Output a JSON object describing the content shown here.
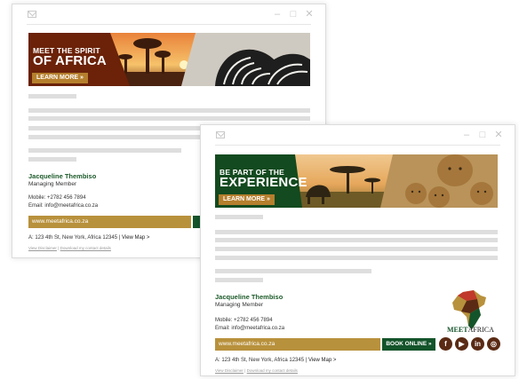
{
  "window_controls": {
    "minimize": "–",
    "maximize": "□",
    "close": "✕"
  },
  "email1": {
    "banner": {
      "line1": "MEET THE SPIRIT",
      "line2": "OF AFRICA",
      "button": "LEARN MORE »"
    },
    "name": "Jacqueline Thembiso",
    "role": "Managing Member",
    "mobile": "Mobile: +2782 456 7894",
    "email": "Email: info@meetafrica.co.za",
    "website": "www.meetafrica.co.za",
    "address": "A: 123 4th St, New York, Africa 12345",
    "separator": "|",
    "view_map": "View Map >",
    "footer_disclaimer": "View Disclaimer",
    "footer_sep": "|",
    "footer_contact": "Download my contact details"
  },
  "email2": {
    "banner": {
      "line1": "BE PART OF THE",
      "line2": "EXPERIENCE",
      "button": "LEARN MORE »"
    },
    "name": "Jacqueline Thembiso",
    "role": "Managing Member",
    "mobile": "Mobile: +2782 456 7894",
    "email": "Email: info@meetafrica.co.za",
    "website": "www.meetafrica.co.za",
    "book_button": "BOOK ONLINE »",
    "address": "A: 123 4th St, New York, Africa 12345",
    "separator": "|",
    "view_map": "View Map >",
    "footer_disclaimer": "View Disclaimer",
    "footer_sep": "|",
    "footer_contact": "Download my contact details",
    "logo": {
      "meet": "MEET",
      "africa": "AFRICA"
    },
    "socials": [
      {
        "icon": "facebook-icon",
        "glyph": "f"
      },
      {
        "icon": "youtube-icon",
        "glyph": "▶"
      },
      {
        "icon": "linkedin-icon",
        "glyph": "in"
      },
      {
        "icon": "instagram-icon",
        "glyph": "◎"
      }
    ]
  },
  "colors": {
    "green": "#14542b",
    "gold": "#b8913c",
    "brown": "#5a2a14",
    "banner1_dark": "#6b2209",
    "banner2_dark": "#134a1f",
    "placeholder": "#dedede"
  }
}
